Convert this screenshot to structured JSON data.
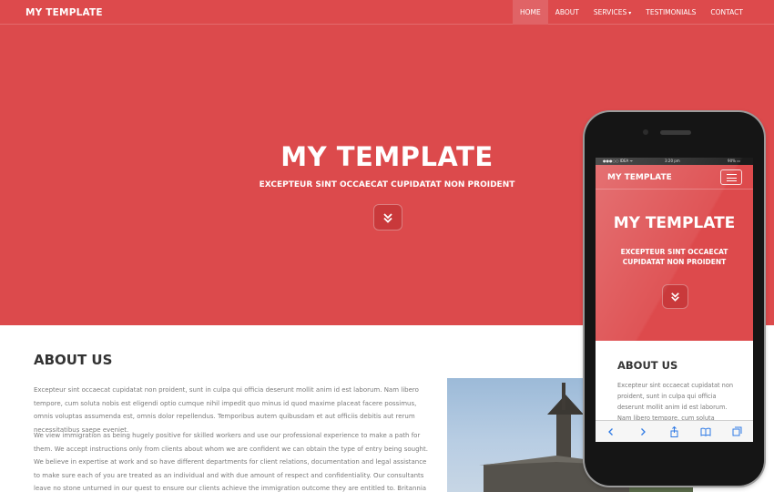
{
  "navbar": {
    "brand": "MY TEMPLATE",
    "items": [
      {
        "label": "HOME",
        "active": true
      },
      {
        "label": "ABOUT"
      },
      {
        "label": "SERVICES"
      },
      {
        "label": "TESTIMONIALS"
      },
      {
        "label": "CONTACT"
      }
    ]
  },
  "hero": {
    "title": "MY TEMPLATE",
    "subtitle": "EXCEPTEUR SINT OCCAECAT CUPIDATAT NON PROIDENT",
    "scroll_icon": "chevrons-down-icon"
  },
  "about": {
    "title": "ABOUT US",
    "paragraph1": "Excepteur sint occaecat cupidatat non proident, sunt in culpa qui officia deserunt mollit anim id est laborum. Nam libero tempore, cum soluta nobis est eligendi optio cumque nihil impedit quo minus id quod maxime placeat facere possimus, omnis voluptas assumenda est, omnis dolor repellendus. Temporibus autem quibusdam et aut officiis debitis aut rerum necessitatibus saepe eveniet.",
    "paragraph2": "We view immigration as being hugely positive for skilled workers and use our professional experience to make a path for them. We accept instructions only from clients about whom we are confident we can obtain the type of entry being sought. We believe in expertise at work and so have different departments for client relations, documentation and legal assistance to make sure each of you are treated as an individual and with due amount of respect and confidentiality. Our consultants leave no stone unturned in our quest to ensure our clients achieve the immigration outcome they are entitled to. Britannia Consultants takes pride in our ability to establish with"
  },
  "phone": {
    "status": {
      "carrier": "●●●○○ IDEA ᯤ",
      "time": "3:20 pm",
      "battery": "90% ▭"
    },
    "brand": "MY TEMPLATE",
    "title": "MY TEMPLATE",
    "subtitle": "EXCEPTEUR SINT OCCAECAT CUPIDATAT NON PROIDENT",
    "about_title": "ABOUT US",
    "about_text": "Excepteur sint occaecat cupidatat non proident, sunt in culpa qui officia deserunt mollit anim id est laborum. Nam libero tempore, cum soluta"
  },
  "colors": {
    "primary": "#dc4a4c",
    "active_nav": "#e06366",
    "button_dark": "#c9393b"
  }
}
